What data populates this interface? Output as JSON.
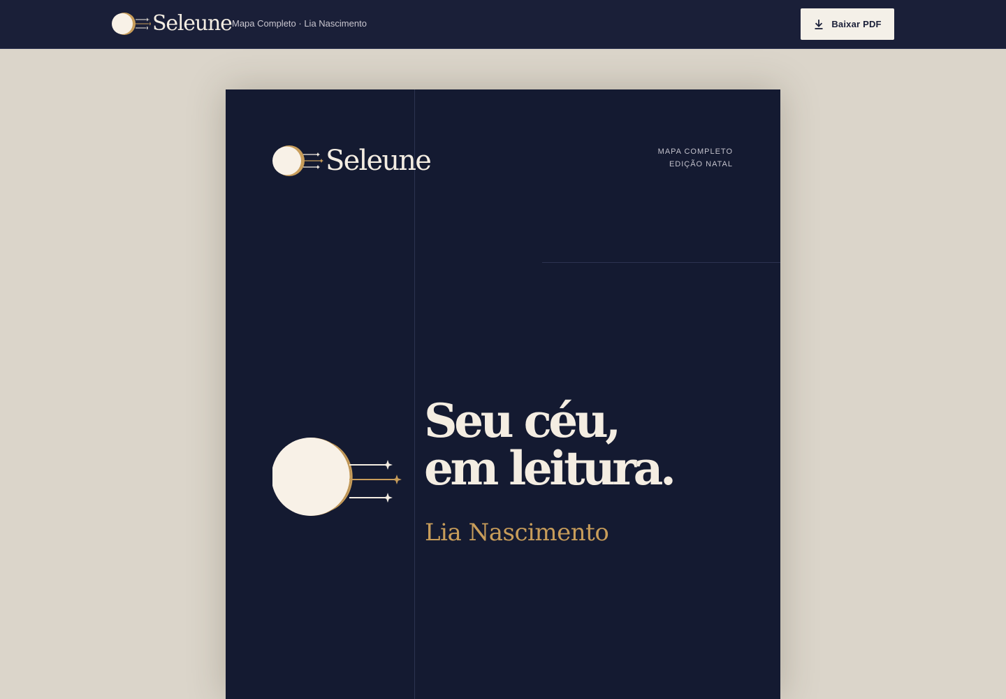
{
  "app": {
    "brand_name": "Seleune",
    "subtitle": "Mapa Completo · Lia Nascimento"
  },
  "toolbar": {
    "download_label": "Baixar PDF",
    "download_icon": "download-icon"
  },
  "document": {
    "brand_name": "Seleune",
    "edition_line1": "MAPA COMPLETO",
    "edition_line2": "EDIÇÃO NATAL",
    "headline_line1": "Seu céu,",
    "headline_line2": "em leitura.",
    "person_name": "Lia Nascimento",
    "logo_icon": "moon-shooting-stars-icon"
  },
  "colors": {
    "topbar_bg": "#1a1f38",
    "page_bg": "#dbd5ca",
    "document_bg": "#141a31",
    "cream": "#f4ede2",
    "gold": "#c89d5a"
  }
}
